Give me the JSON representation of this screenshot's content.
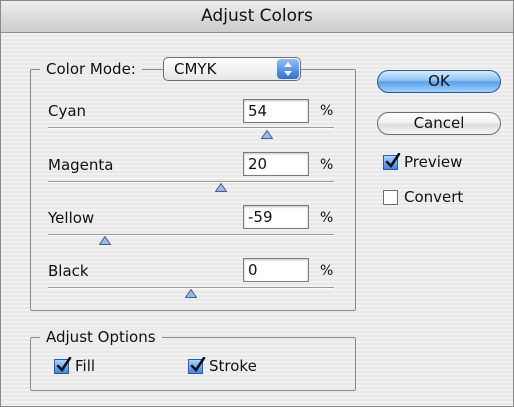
{
  "dialog": {
    "title": "Adjust Colors"
  },
  "color_mode": {
    "label": "Color Mode:",
    "selected": "CMYK"
  },
  "sliders": [
    {
      "label": "Cyan",
      "value": "54",
      "unit": "%"
    },
    {
      "label": "Magenta",
      "value": "20",
      "unit": "%"
    },
    {
      "label": "Yellow",
      "value": "-59",
      "unit": "%"
    },
    {
      "label": "Black",
      "value": "0",
      "unit": "%"
    }
  ],
  "buttons": {
    "ok": "OK",
    "cancel": "Cancel"
  },
  "options": {
    "preview": {
      "label": "Preview",
      "checked": true
    },
    "convert": {
      "label": "Convert",
      "checked": false
    }
  },
  "adjust_options": {
    "title": "Adjust Options",
    "fill": {
      "label": "Fill",
      "checked": true
    },
    "stroke": {
      "label": "Stroke",
      "checked": true
    }
  },
  "colors": {
    "default_button": "#6aaaf0",
    "check_on": "#3c86e6",
    "thumb": "#9db9e8"
  }
}
